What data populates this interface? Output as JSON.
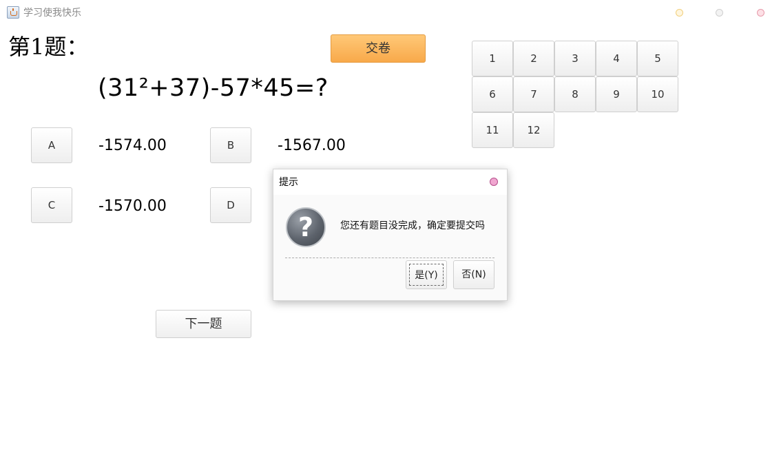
{
  "window": {
    "title": "学习使我快乐",
    "controls": [
      {
        "name": "minimize",
        "fill": "#fff6df",
        "border": "#f1cf7c"
      },
      {
        "name": "maximize",
        "fill": "#f3f3f3",
        "border": "#cfcfcf"
      },
      {
        "name": "close",
        "fill": "#fde0e6",
        "border": "#e79aaa"
      }
    ]
  },
  "question": {
    "number_label": "第1题：",
    "expression": "(31²+37)-57*45=?"
  },
  "submit_label": "交卷",
  "options": [
    {
      "key": "A",
      "value": "-1574.00"
    },
    {
      "key": "B",
      "value": "-1567.00"
    },
    {
      "key": "C",
      "value": "-1570.00"
    },
    {
      "key": "D",
      "value": ""
    }
  ],
  "next_label": "下一题",
  "grid": [
    "1",
    "2",
    "3",
    "4",
    "5",
    "6",
    "7",
    "8",
    "9",
    "10",
    "11",
    "12"
  ],
  "dialog": {
    "title": "提示",
    "message": "您还有题目没完成，确定要提交吗",
    "icon": "question-icon",
    "yes_label": "是(Y)",
    "no_label": "否(N)"
  },
  "colors": {
    "submit_button": "#f8a94a",
    "dialog_close": "#f0a6d0"
  }
}
